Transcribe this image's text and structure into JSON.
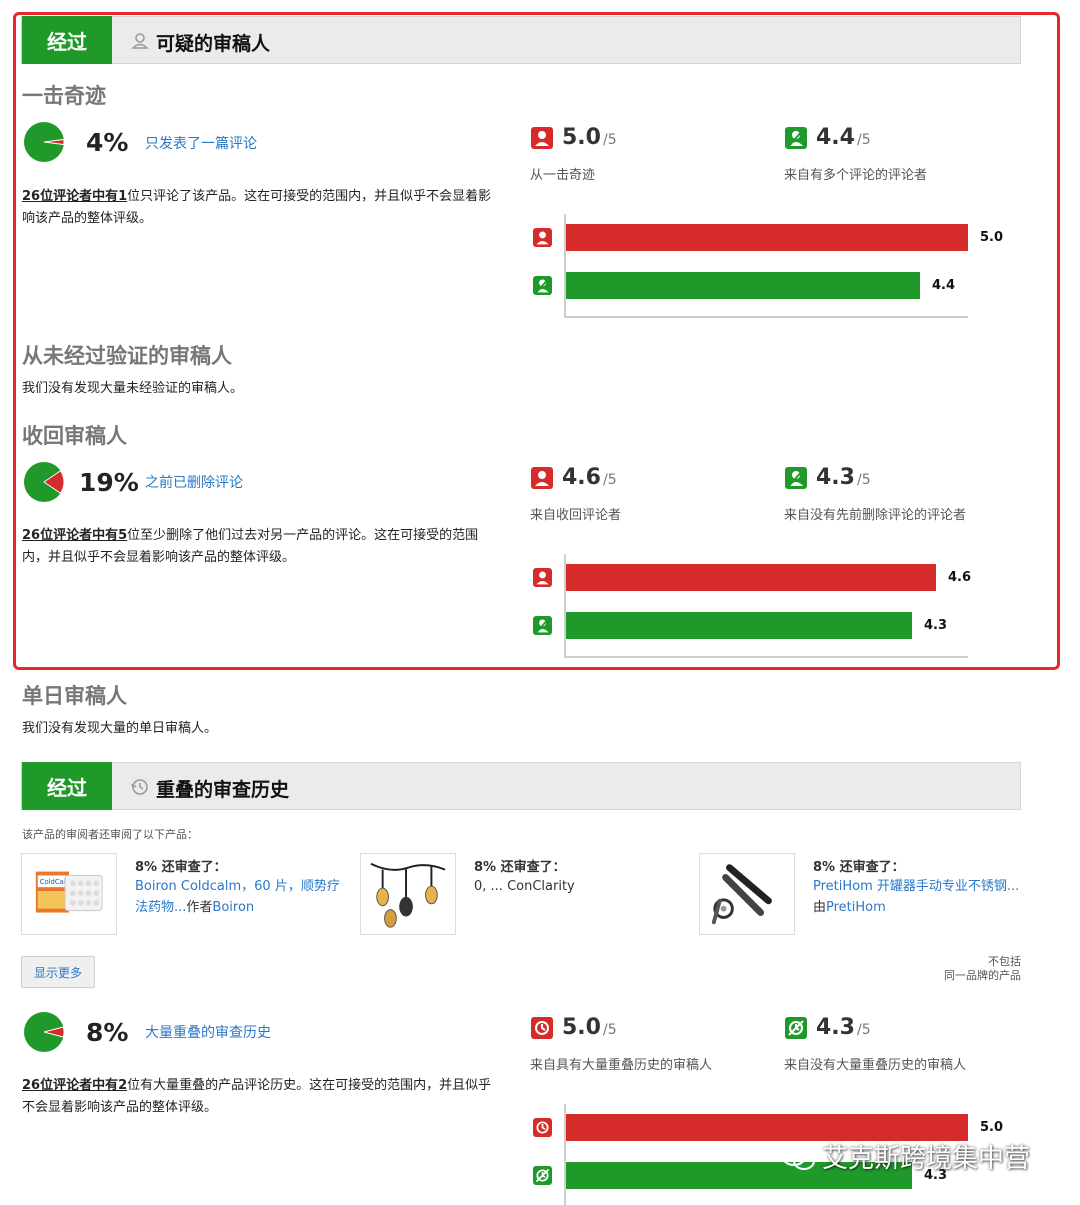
{
  "colors": {
    "pass": "#1f9a2a",
    "fail": "#d52b2b",
    "link": "#2a78c8",
    "highlight": "#e8262d"
  },
  "section1": {
    "badge": "经过",
    "icon": "user-silhouette-icon",
    "title": "可疑的审稿人",
    "one_hit": {
      "title": "一击奇迹",
      "percent_value": 4,
      "percent": "4%",
      "link": "只发表了一篇评论",
      "desc_bold": "26位评论者中有1",
      "desc_rest": "位只评论了该产品。这在可接受的范围内，并且似乎不会显着影响该产品的整体评级。",
      "score_a": {
        "value": "5.0",
        "denom": "/5",
        "caption": "从一击奇迹",
        "icon": "reviewer-red-icon"
      },
      "score_b": {
        "value": "4.4",
        "denom": "/5",
        "caption": "来自有多个评论的评论者",
        "icon": "reviewer-crossed-green-icon"
      },
      "bars": [
        {
          "label": "5.0",
          "value": 5.0
        },
        {
          "label": "4.4",
          "value": 4.4
        }
      ]
    },
    "unverified": {
      "title": "从未经过验证的审稿人",
      "desc": "我们没有发现大量未经验证的审稿人。"
    },
    "takeback": {
      "title": "收回审稿人",
      "percent_value": 19,
      "percent": "19%",
      "link": "之前已删除评论",
      "desc_bold": "26位评论者中有5",
      "desc_rest": "位至少删除了他们过去对另一产品的评论。这在可接受的范围内，并且似乎不会显着影响该产品的整体评级。",
      "score_a": {
        "value": "4.6",
        "denom": "/5",
        "caption": "来自收回评论者",
        "icon": "reviewer-red-icon"
      },
      "score_b": {
        "value": "4.3",
        "denom": "/5",
        "caption": "来自没有先前删除评论的评论者",
        "icon": "reviewer-crossed-green-icon"
      },
      "bars": [
        {
          "label": "4.6",
          "value": 4.6
        },
        {
          "label": "4.3",
          "value": 4.3
        }
      ]
    },
    "single_day": {
      "title": "单日审稿人",
      "desc": "我们没有发现大量的单日审稿人。"
    }
  },
  "section2": {
    "badge": "经过",
    "icon": "history-icon",
    "title": "重叠的审查历史",
    "intro": "该产品的审阅者还审阅了以下产品：",
    "products": [
      {
        "head": "8% 还审查了：",
        "name": "Boiron Coldcalm，60 片，顺势疗法药物...",
        "by": "作者",
        "brand": "Boiron",
        "icon": "coldcalm-box-thumb"
      },
      {
        "head": "8% 还审查了：",
        "name": "0, ... ConClarity",
        "by": "",
        "brand": "",
        "icon": "string-lights-thumb"
      },
      {
        "head": "8% 还审查了：",
        "name": "PretiHom 开罐器手动专业不锈钢...",
        "by": "由",
        "brand": "PretiHom",
        "icon": "can-opener-thumb"
      }
    ],
    "more_button": "显示更多",
    "exclude_note_1": "不包括",
    "exclude_note_2": "同一品牌的产品",
    "overlap": {
      "percent_value": 8,
      "percent": "8%",
      "link": "大量重叠的审查历史",
      "desc_bold": "26位评论者中有2",
      "desc_rest": "位有大量重叠的产品评论历史。这在可接受的范围内，并且似乎不会显着影响该产品的整体评级。",
      "score_a": {
        "value": "5.0",
        "denom": "/5",
        "caption": "来自具有大量重叠历史的审稿人",
        "icon": "history-red-icon"
      },
      "score_b": {
        "value": "4.3",
        "denom": "/5",
        "caption": "来自没有大量重叠历史的审稿人",
        "icon": "history-crossed-green-icon"
      },
      "bars": [
        {
          "label": "5.0",
          "value": 5.0
        },
        {
          "label": "4.3",
          "value": 4.3
        }
      ]
    }
  },
  "watermark": "艾克斯跨境集中营"
}
